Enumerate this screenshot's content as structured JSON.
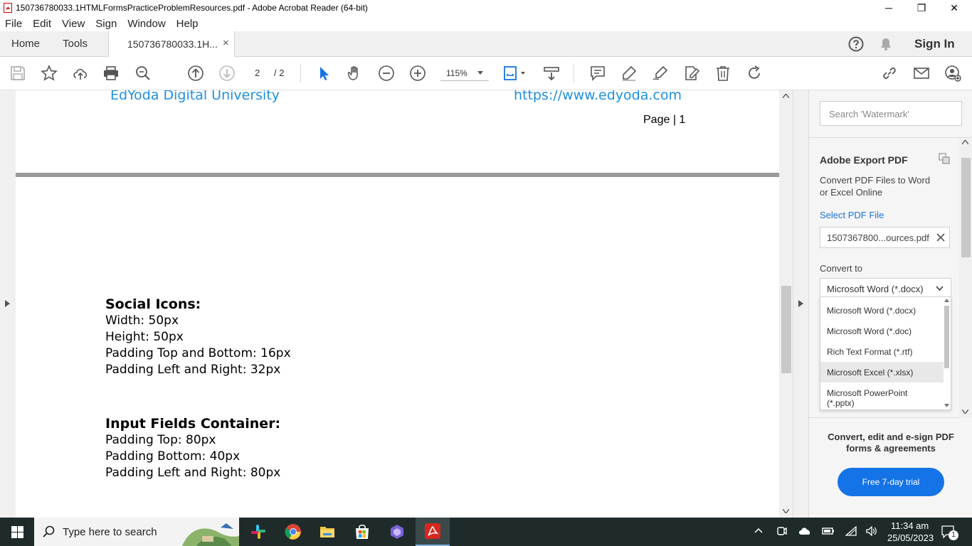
{
  "window": {
    "title": "150736780033.1HTMLFormsPracticeProblemResources.pdf - Adobe Acrobat Reader (64-bit)",
    "controls": {
      "minimize": "─",
      "restore": "❐",
      "close": "✕"
    }
  },
  "menu": [
    "File",
    "Edit",
    "View",
    "Sign",
    "Window",
    "Help"
  ],
  "tabs": {
    "home": "Home",
    "tools": "Tools",
    "document": "150736780033.1H...",
    "close": "×",
    "sign_in": "Sign In"
  },
  "toolbar": {
    "page_current": "2",
    "page_total": "/ 2",
    "zoom": "115%"
  },
  "document": {
    "header_left": "EdYoda Digital University",
    "header_right": "https://www.edyoda.com",
    "page_label": "Page | 1",
    "sections": [
      {
        "heading": "Social Icons:",
        "lines": [
          "Width: 50px",
          "Height: 50px",
          "Padding Top and Bottom: 16px",
          "Padding Left and Right: 32px"
        ]
      },
      {
        "heading": "Input Fields Container:",
        "lines": [
          "Padding Top: 80px",
          "Padding Bottom: 40px",
          "Padding Left and Right: 80px"
        ]
      }
    ]
  },
  "right_pane": {
    "search_placeholder": "Search 'Watermark'",
    "export_title": "Adobe Export PDF",
    "export_desc_1": "Convert PDF Files to Word",
    "export_desc_2": "or Excel Online",
    "select_label": "Select PDF File",
    "file_name": "1507367800...ources.pdf",
    "convert_label": "Convert to",
    "selected_format": "Microsoft Word (*.docx)",
    "formats": [
      "Microsoft Word (*.docx)",
      "Microsoft Word (*.doc)",
      "Rich Text Format (*.rtf)",
      "Microsoft Excel (*.xlsx)",
      "Microsoft PowerPoint (*.pptx)"
    ],
    "highlighted_format_index": 3,
    "promo_1": "Convert, edit and e-sign PDF",
    "promo_2": "forms & agreements",
    "trial_button": "Free 7-day trial"
  },
  "taskbar": {
    "search_text": "Type here to search",
    "time": "11:34 am",
    "date": "25/05/2023",
    "notification_count": "1"
  },
  "colors": {
    "accent": "#1473e6",
    "link": "#1a73d9",
    "pdf_header": "#1e90e0",
    "taskbar": "#1f2b2b"
  }
}
